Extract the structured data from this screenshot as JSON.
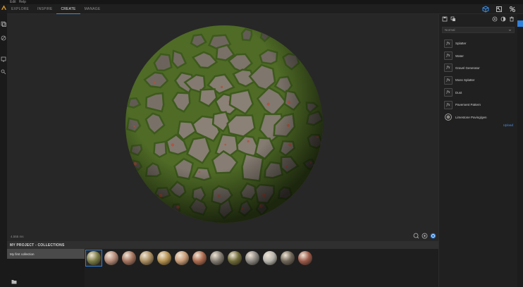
{
  "menu": {
    "items": [
      "Edit",
      "Help"
    ]
  },
  "nav": {
    "tabs": [
      {
        "label": "EXPLORE",
        "active": false
      },
      {
        "label": "INSPIRE",
        "active": false
      },
      {
        "label": "CREATE",
        "active": true
      },
      {
        "label": "MANAGE",
        "active": false
      }
    ],
    "icons": [
      "cube-view-icon",
      "expand-icon",
      "split-view-icon"
    ]
  },
  "left_toolbar": {
    "icons": [
      "layers-icon",
      "paint-icon",
      "export-icon",
      "share-icon"
    ]
  },
  "viewport": {
    "status_text": "4.555 ms",
    "tools": [
      "zoom-icon",
      "camera-settings-icon",
      "environment-icon"
    ],
    "material": {
      "name": "mossy stone pavement",
      "colors": [
        "#8c8278",
        "#5a7a2e",
        "#b4503a"
      ]
    }
  },
  "right_panel": {
    "top_icons": [
      "save-icon",
      "layers-stack-icon",
      "render-icon",
      "contrast-icon",
      "trash-icon"
    ],
    "dropdown_value": "Normal",
    "effects": [
      {
        "label": "Splatter",
        "icon": "fx"
      },
      {
        "label": "Water",
        "icon": "fx"
      },
      {
        "label": "Gravel Generator",
        "icon": "fx"
      },
      {
        "label": "Moss Splatter",
        "icon": "fx"
      },
      {
        "label": "Dust",
        "icon": "fx"
      },
      {
        "label": "Pavement Pattern",
        "icon": "fx"
      },
      {
        "label": "Limestone Paving/gen",
        "icon": "material"
      }
    ],
    "link_label": "Upload"
  },
  "bottom": {
    "header": "MY PROJECT - COLLECTIONS",
    "collection_label": "My first collection",
    "thumbnails": [
      {
        "name": "mossy-stone",
        "color": "#7a7c45",
        "selected": true
      },
      {
        "name": "rose-clay",
        "color": "#b48a78",
        "selected": false
      },
      {
        "name": "terracotta-clay",
        "color": "#a5745e",
        "selected": false
      },
      {
        "name": "sandstone",
        "color": "#a98d60",
        "selected": false
      },
      {
        "name": "ochre-plaster",
        "color": "#b3904f",
        "selected": false
      },
      {
        "name": "peach-stucco",
        "color": "#c69a76",
        "selected": false
      },
      {
        "name": "rust-concrete",
        "color": "#ad6b4f",
        "selected": false
      },
      {
        "name": "grey-gravel",
        "color": "#807a70",
        "selected": false
      },
      {
        "name": "moss-ground",
        "color": "#6e6a38",
        "selected": false
      },
      {
        "name": "granite",
        "color": "#8a8680",
        "selected": false
      },
      {
        "name": "white-marble",
        "color": "#b6b4ac",
        "selected": false
      },
      {
        "name": "dark-cobble",
        "color": "#6f6658",
        "selected": false
      },
      {
        "name": "red-brick",
        "color": "#9c5a4a",
        "selected": false
      }
    ]
  },
  "colors": {
    "accent": "#2f7fdb",
    "background": "#1b1b1b",
    "viewport": "#272727"
  }
}
